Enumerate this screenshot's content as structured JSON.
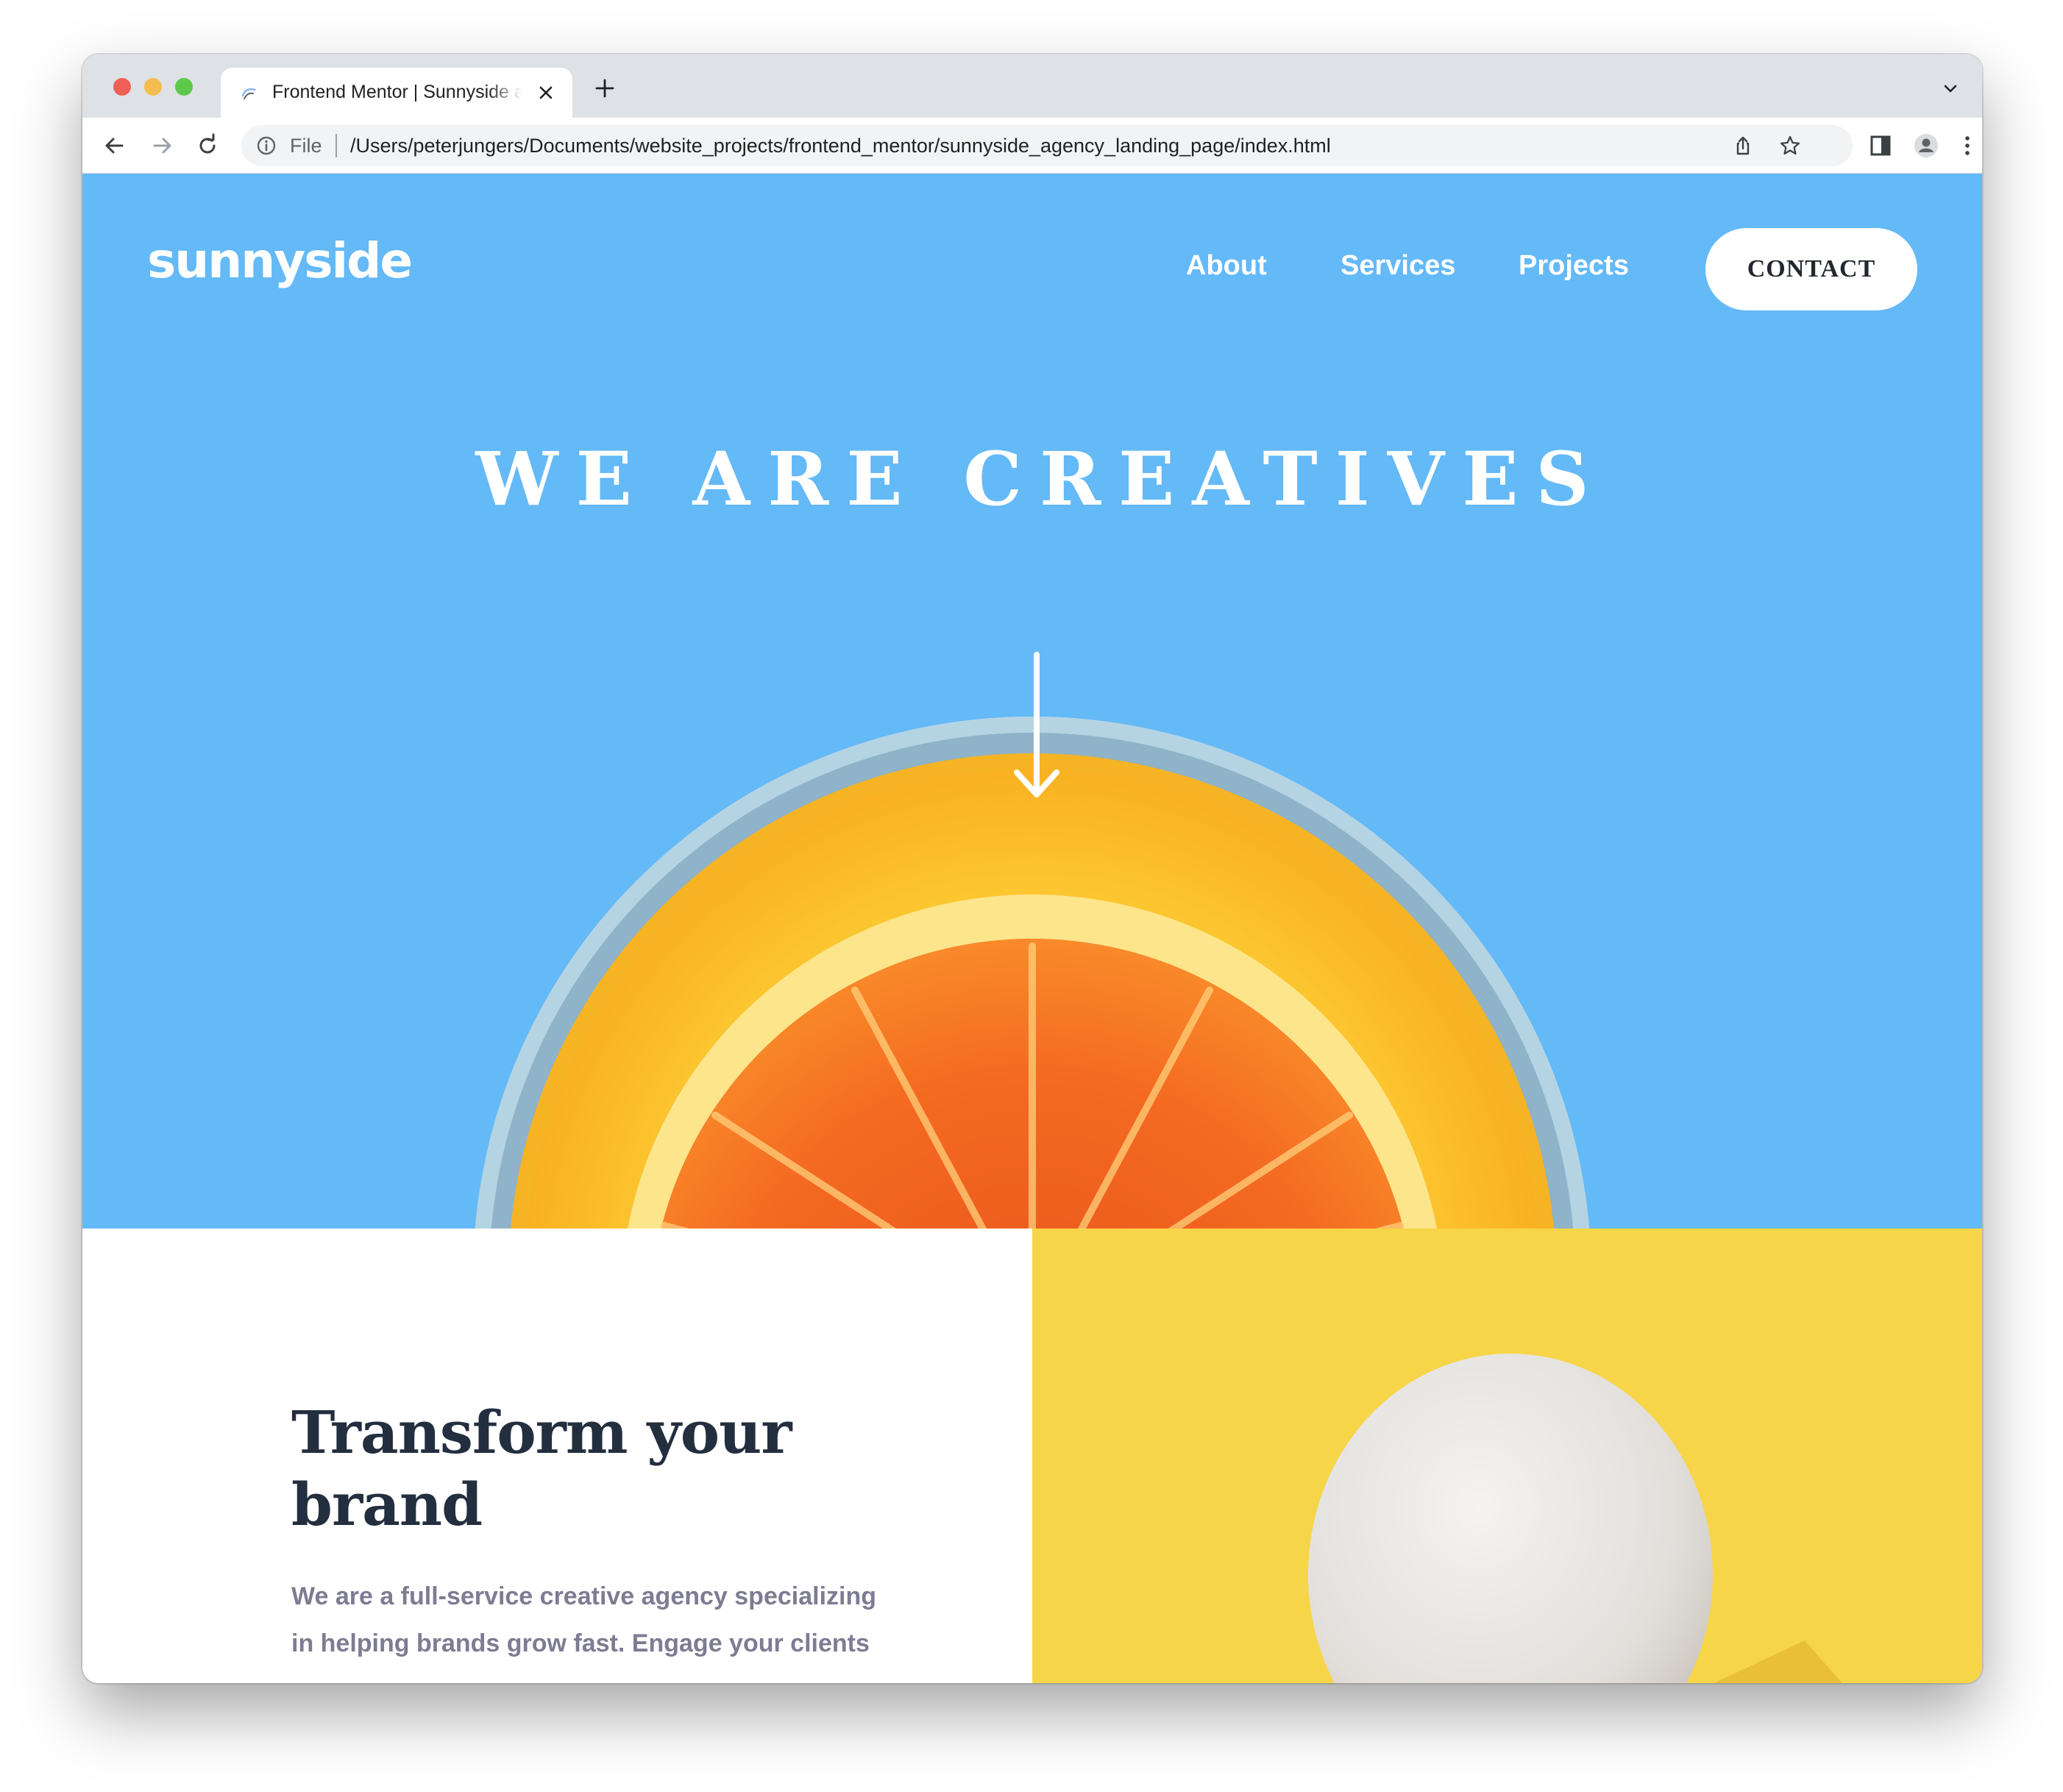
{
  "browser": {
    "tab_title": "Frontend Mentor | Sunnyside agency landing page",
    "url_scheme": "File",
    "url_path": "/Users/peterjungers/Documents/website_projects/frontend_mentor/sunnyside_agency_landing_page/index.html",
    "icons": [
      "back-icon",
      "forward-icon",
      "reload-icon",
      "info-icon",
      "share-icon",
      "star-icon",
      "sidebar-icon",
      "profile-icon",
      "more-icon",
      "close-icon",
      "plus-icon",
      "chevron-down-icon"
    ]
  },
  "header": {
    "logo": "sunnyside",
    "nav": [
      {
        "label": "About"
      },
      {
        "label": "Services"
      },
      {
        "label": "Projects"
      }
    ],
    "contact_label": "CONTACT"
  },
  "hero": {
    "title": "WE ARE CREATIVES",
    "background": "#64b9f7"
  },
  "transform": {
    "title": "Transform your brand",
    "body": "We are a full-service creative agency specializing in helping brands grow fast. Engage your clients"
  },
  "colors": {
    "hero_blue": "#64b9f7",
    "egg_yellow": "#f7d548",
    "heading_dark": "#232e3f",
    "body_gray": "#7e7c93"
  }
}
